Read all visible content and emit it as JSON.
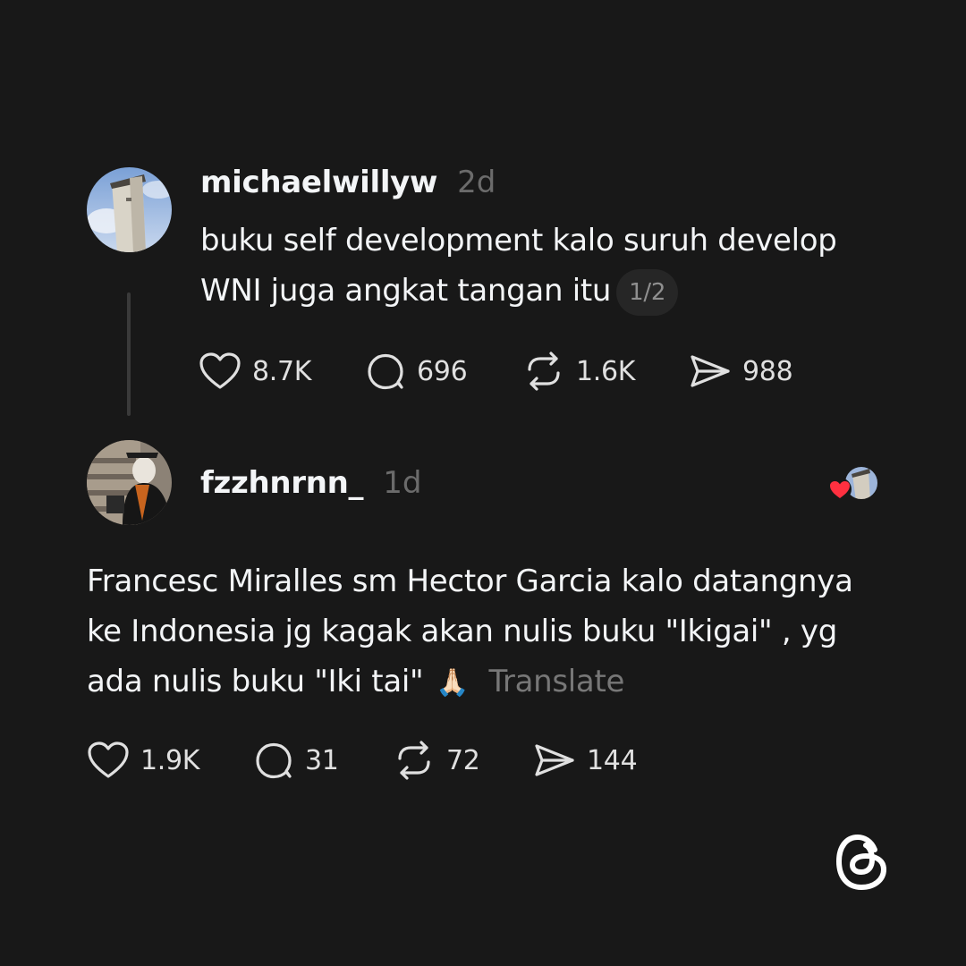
{
  "posts": [
    {
      "username": "michaelwillyw",
      "time": "2d",
      "text_line1": "buku self development kalo suruh develop",
      "text_line2": "WNI juga angkat tangan itu",
      "page_indicator": "1/2",
      "likes": "8.7K",
      "replies": "696",
      "reposts": "1.6K",
      "shares": "988"
    },
    {
      "username": "fzzhnrnn_",
      "time": "1d",
      "text_line1": "Francesc Miralles sm Hector Garcia kalo datangnya",
      "text_line2": "ke Indonesia jg kagak akan nulis buku \"Ikigai\" , yg",
      "text_line3": "ada nulis buku \"Iki tai\"",
      "emoji": "🙏🏻",
      "translate": "Translate",
      "likes": "1.9K",
      "replies": "31",
      "reposts": "72",
      "shares": "144"
    }
  ],
  "icons": {
    "like": "heart-icon",
    "reply": "comment-icon",
    "repost": "repost-icon",
    "share": "send-icon",
    "brand": "threads-logo-icon"
  },
  "colors": {
    "background": "#181818",
    "text": "#f3f5f7",
    "muted": "#6b6b6b",
    "like_heart": "#ff3040"
  }
}
